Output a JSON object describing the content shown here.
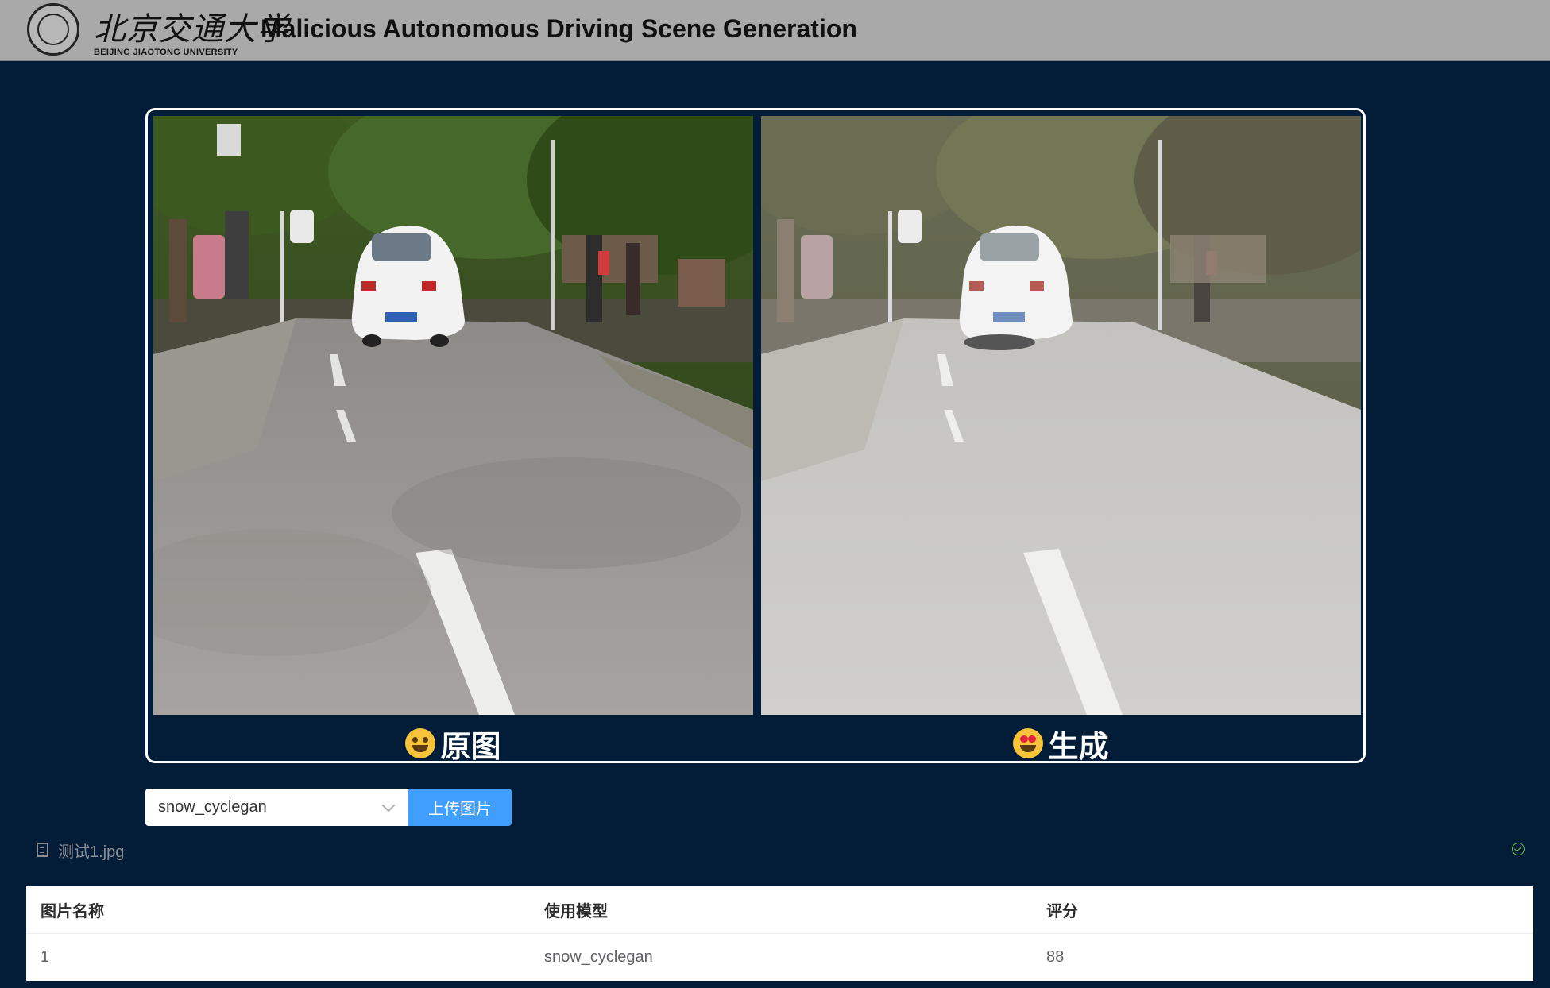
{
  "header": {
    "university_cn": "北京交通大学",
    "university_en": "BEIJING JIAOTONG UNIVERSITY",
    "title": "Malicious Autonomous Driving Scene Generation"
  },
  "images": {
    "original_caption": "原图",
    "generated_caption": "生成"
  },
  "controls": {
    "model_select_value": "snow_cyclegan",
    "upload_label": "上传图片"
  },
  "file": {
    "name": "测试1.jpg"
  },
  "table": {
    "headers": [
      "图片名称",
      "使用模型",
      "评分"
    ],
    "rows": [
      [
        "1",
        "snow_cyclegan",
        "88"
      ]
    ]
  }
}
